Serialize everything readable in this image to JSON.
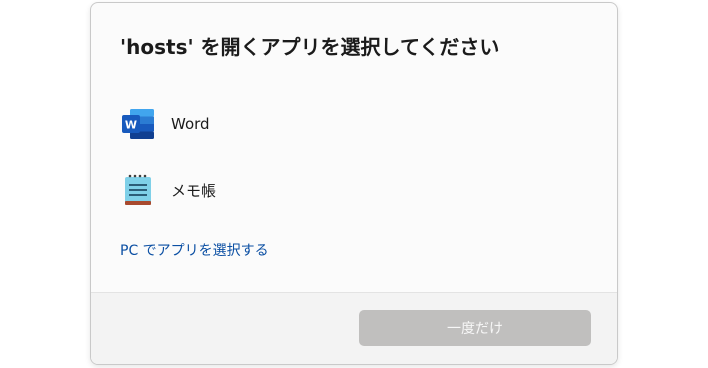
{
  "dialog": {
    "title": "'hosts' を開くアプリを選択してください",
    "apps": [
      {
        "name": "Word",
        "icon": "word-icon"
      },
      {
        "name": "メモ帳",
        "icon": "notepad-icon"
      }
    ],
    "choose_on_pc_link": "PC でアプリを選択する",
    "once_button": "一度だけ"
  },
  "colors": {
    "link": "#0b4fa3",
    "button_disabled": "#c0bfbe",
    "word_blue": "#185abd"
  }
}
